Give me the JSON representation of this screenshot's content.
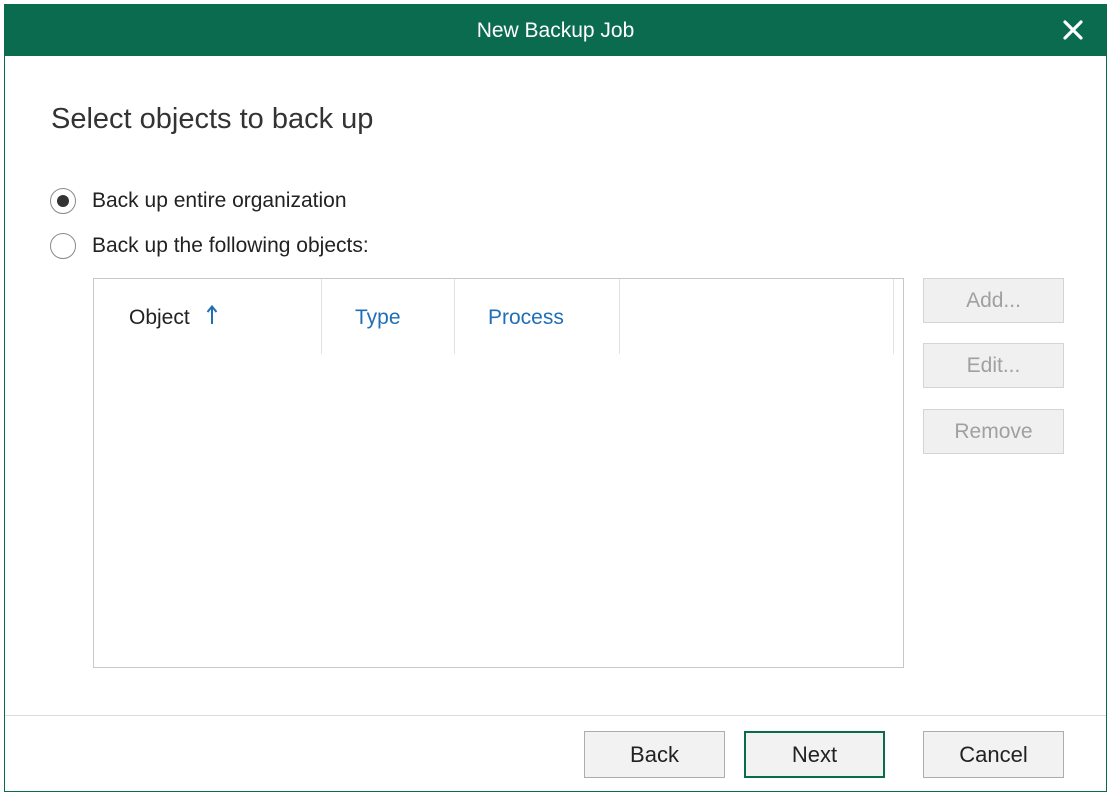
{
  "window": {
    "title": "New Backup Job",
    "accent_color": "#0b6b4f",
    "close_icon": "close-icon"
  },
  "page": {
    "heading": "Select objects to back up"
  },
  "options": [
    {
      "label": "Back up entire organization",
      "selected": true
    },
    {
      "label": "Back up the following objects:",
      "selected": false
    }
  ],
  "grid": {
    "columns": [
      {
        "label": "Object",
        "sorted": "ascending",
        "sort_icon": "sort-ascending-icon"
      },
      {
        "label": "Type"
      },
      {
        "label": "Process"
      }
    ],
    "rows": []
  },
  "side_buttons": {
    "add": "Add...",
    "edit": "Edit...",
    "remove": "Remove"
  },
  "footer": {
    "back": "Back",
    "next": "Next",
    "cancel": "Cancel"
  }
}
